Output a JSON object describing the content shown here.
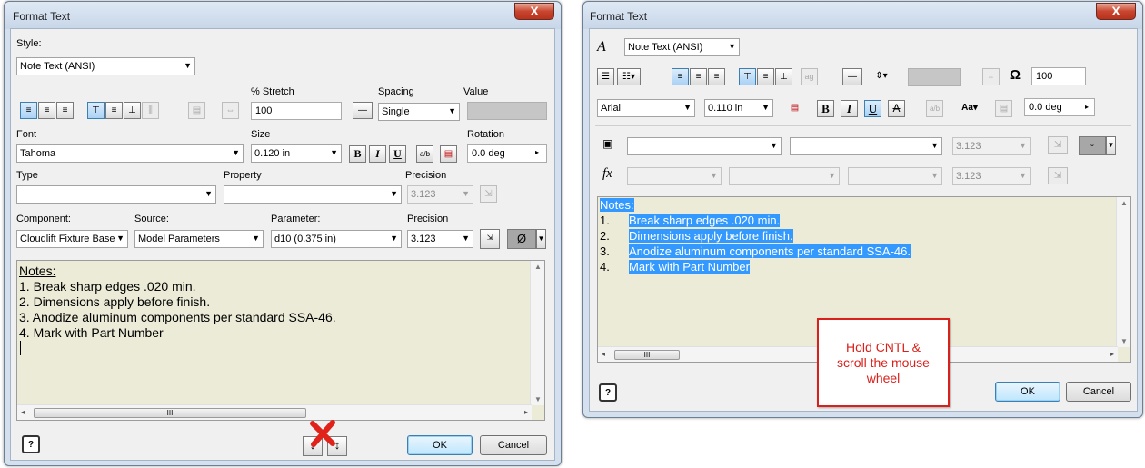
{
  "left_dialog": {
    "title": "Format Text",
    "close_label": "X",
    "style_label": "Style:",
    "style_value": "Note Text (ANSI)",
    "stretch_label": "% Stretch",
    "stretch_value": "100",
    "spacing_label": "Spacing",
    "spacing_value": "Single",
    "value_label": "Value",
    "font_label": "Font",
    "font_value": "Tahoma",
    "size_label": "Size",
    "size_value": "0.120 in",
    "bold": "B",
    "italic": "I",
    "underline": "U",
    "rotation_label": "Rotation",
    "rotation_value": "0.0 deg",
    "type_label": "Type",
    "property_label": "Property",
    "precision_label": "Precision",
    "precision_value_disabled": "3.123",
    "component_label": "Component:",
    "component_value": "Cloudlift Fixture Base",
    "source_label": "Source:",
    "source_value": "Model Parameters",
    "parameter_label": "Parameter:",
    "parameter_value": "d10 (0.375 in)",
    "precision2_label": "Precision",
    "precision2_value": "3.123",
    "symbol_value": "Ø",
    "notes": [
      "Notes:",
      "1. Break sharp edges .020 min.",
      "2. Dimensions apply before finish.",
      "3. Anodize aluminum components per standard SSA-46.",
      "4. Mark with Part Number"
    ],
    "hscroll_grip": "III",
    "help_label": "?",
    "ok_label": "OK",
    "cancel_label": "Cancel"
  },
  "right_dialog": {
    "title": "Format Text",
    "close_label": "X",
    "style_value": "Note Text (ANSI)",
    "stretch_value": "100",
    "font_value": "Arial",
    "size_value": "0.110 in",
    "bold": "B",
    "italic": "I",
    "underline": "U",
    "strike": "A",
    "rotation_value": "0.0 deg",
    "precision_a": "3.123",
    "precision_b": "3.123",
    "fx_label": "fx",
    "notes_header": "Notes:",
    "notes": [
      {
        "num": "1.",
        "text": "Break sharp edges .020 min."
      },
      {
        "num": "2.",
        "text": "Dimensions apply before finish."
      },
      {
        "num": "3.",
        "text": "Anodize aluminum components per standard SSA-46."
      },
      {
        "num": "4.",
        "text": "Mark with Part Number"
      }
    ],
    "hscroll_grip": "III",
    "callout": "Hold CNTL & scroll the mouse wheel",
    "help_label": "?",
    "ok_label": "OK",
    "cancel_label": "Cancel"
  },
  "colors": {
    "selection": "#3399ff",
    "editor_bg": "#ecebd7",
    "callout_border": "#d9211c",
    "callout_text": "#d9211c",
    "red_x": "#e0221a"
  }
}
